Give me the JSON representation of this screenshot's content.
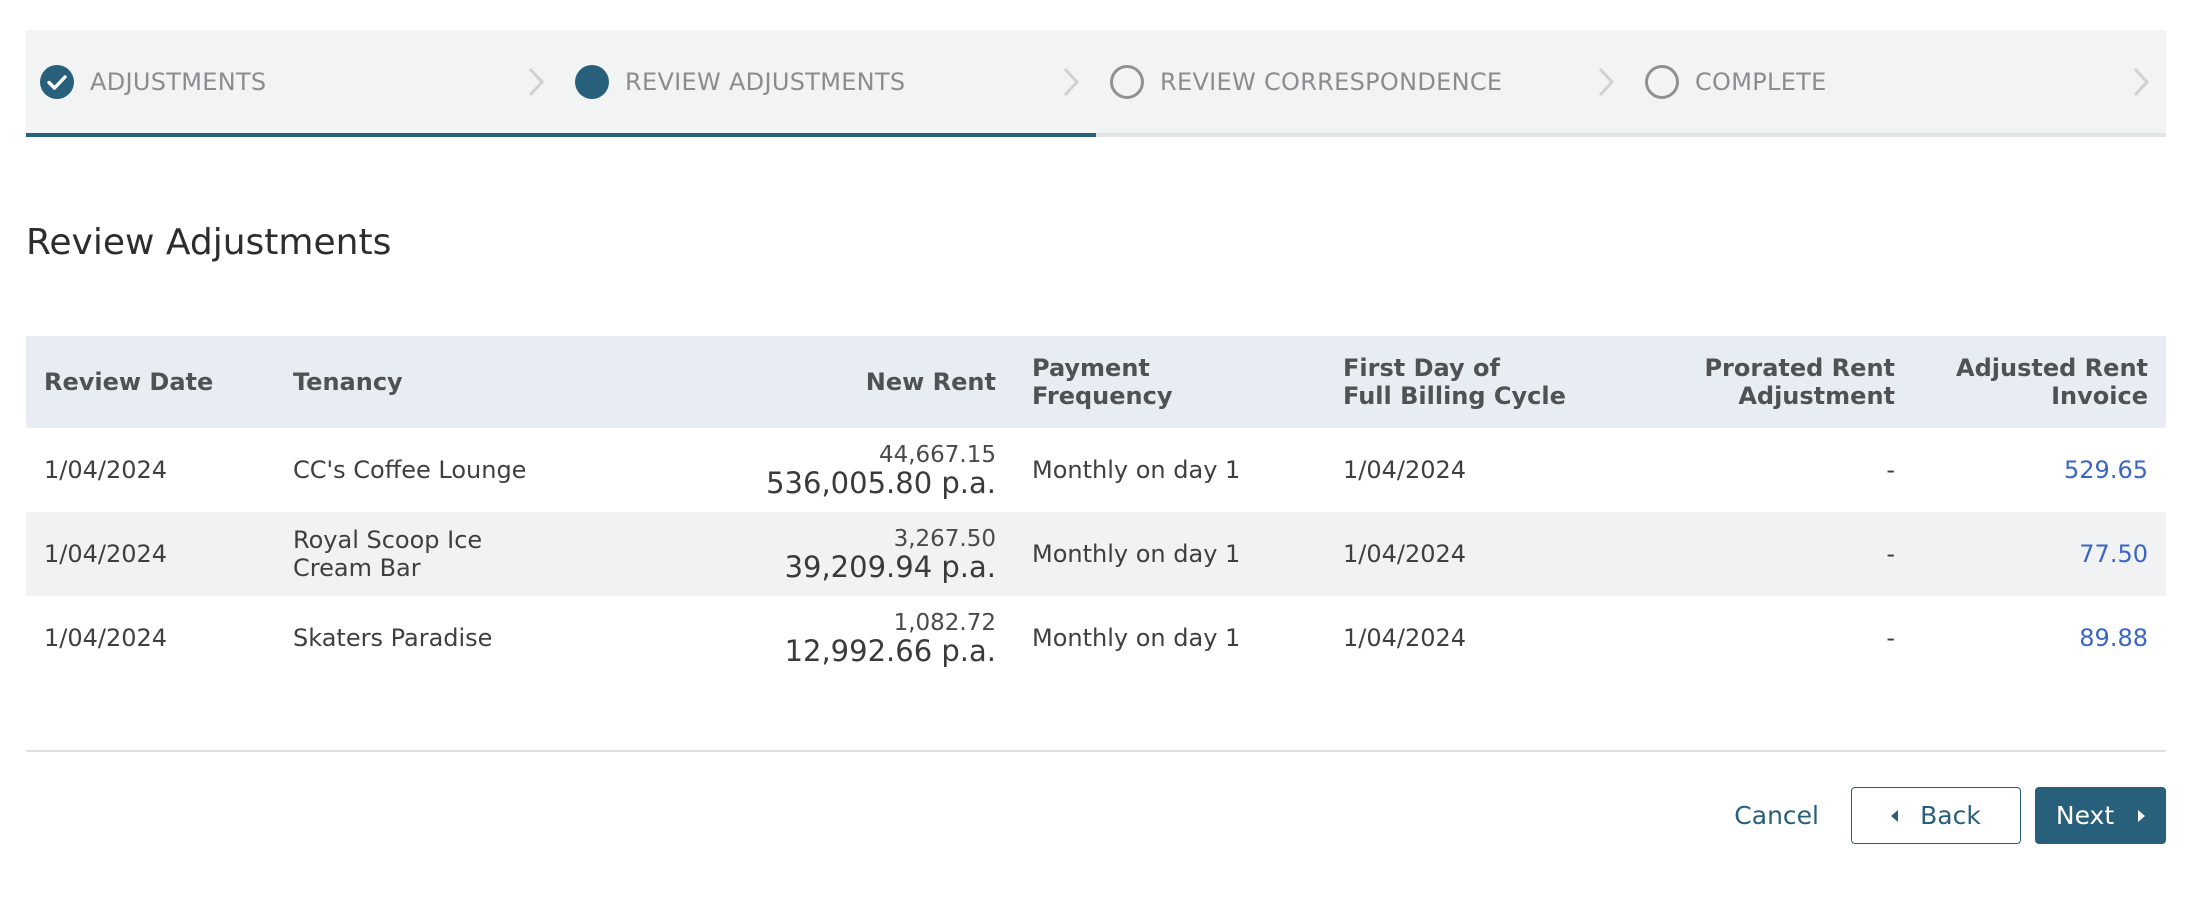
{
  "stepper": {
    "steps": [
      {
        "label": "ADJUSTMENTS",
        "state": "done"
      },
      {
        "label": "REVIEW ADJUSTMENTS",
        "state": "current"
      },
      {
        "label": "REVIEW CORRESPONDENCE",
        "state": "todo"
      },
      {
        "label": "COMPLETE",
        "state": "todo"
      }
    ],
    "progress_fraction": 0.5
  },
  "page": {
    "title": "Review Adjustments"
  },
  "table": {
    "headers": {
      "review_date": "Review Date",
      "tenancy": "Tenancy",
      "new_rent": "New Rent",
      "payment_frequency_1": "Payment",
      "payment_frequency_2": "Frequency",
      "first_day_1": "First Day of",
      "first_day_2": "Full Billing Cycle",
      "prorated_1": "Prorated Rent",
      "prorated_2": "Adjustment",
      "adjusted_1": "Adjusted Rent",
      "adjusted_2": "Invoice"
    },
    "rows": [
      {
        "review_date": "1/04/2024",
        "tenancy": "CC's Coffee Lounge",
        "rent_monthly": "44,667.15",
        "rent_annual": "536,005.80 p.a.",
        "payment_frequency": "Monthly on day 1",
        "first_day": "1/04/2024",
        "prorated": "-",
        "adjusted_invoice": "529.65"
      },
      {
        "review_date": "1/04/2024",
        "tenancy": "Royal Scoop Ice Cream Bar",
        "rent_monthly": "3,267.50",
        "rent_annual": "39,209.94 p.a.",
        "payment_frequency": "Monthly on day 1",
        "first_day": "1/04/2024",
        "prorated": "-",
        "adjusted_invoice": "77.50"
      },
      {
        "review_date": "1/04/2024",
        "tenancy": "Skaters Paradise",
        "rent_monthly": "1,082.72",
        "rent_annual": "12,992.66 p.a.",
        "payment_frequency": "Monthly on day 1",
        "first_day": "1/04/2024",
        "prorated": "-",
        "adjusted_invoice": "89.88"
      }
    ]
  },
  "footer": {
    "cancel_label": "Cancel",
    "back_label": "Back",
    "next_label": "Next"
  },
  "colors": {
    "primary": "#285f7b",
    "link": "#3a66c4",
    "header_bg": "#e8edf3",
    "stepper_bg": "#f2f3f3"
  }
}
